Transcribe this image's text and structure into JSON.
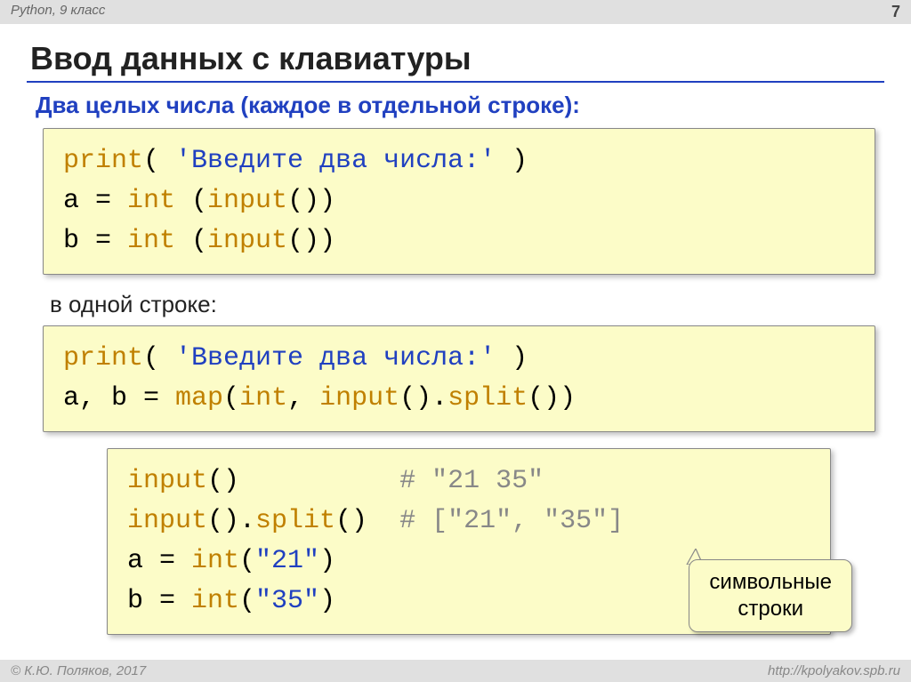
{
  "header": {
    "left": "Python, 9 класс",
    "page": "7"
  },
  "title": "Ввод данных с клавиатуры",
  "subtitle": "Два целых числа (каждое в отдельной строке):",
  "code1": {
    "print": "print",
    "lparen": "( ",
    "str": "'Введите два числа:'",
    "rparen": " )",
    "l2a": "a = ",
    "int": "int",
    "l2b": " (",
    "input": "input",
    "l2c": "())",
    "l3a": "b = ",
    "l3b": " (",
    "l3c": "())"
  },
  "note1": "в одной строке:",
  "code2": {
    "print": "print",
    "lparen": "( ",
    "str": "'Введите два числа:'",
    "rparen": " )",
    "l2a": "a, b = ",
    "map": "map",
    "l2b": "(",
    "int": "int",
    "l2c": ", ",
    "input": "input",
    "l2d": "().",
    "split": "split",
    "l2e": "())"
  },
  "code3": {
    "input": "input",
    "l1a": "()          ",
    "c1": "# \"21 35\"",
    "l2a": "().",
    "split": "split",
    "l2b": "()  ",
    "c2": "# [\"21\", \"35\"]",
    "l3a": "a = ",
    "int": "int",
    "l3b": "(",
    "s21": "\"21\"",
    "l3c": ")",
    "l4a": "b = ",
    "l4b": "(",
    "s35": "\"35\"",
    "l4c": ")"
  },
  "callout": {
    "line1": "символьные",
    "line2": "строки"
  },
  "footer": {
    "left": "© К.Ю. Поляков, 2017",
    "right": "http://kpolyakov.spb.ru"
  }
}
